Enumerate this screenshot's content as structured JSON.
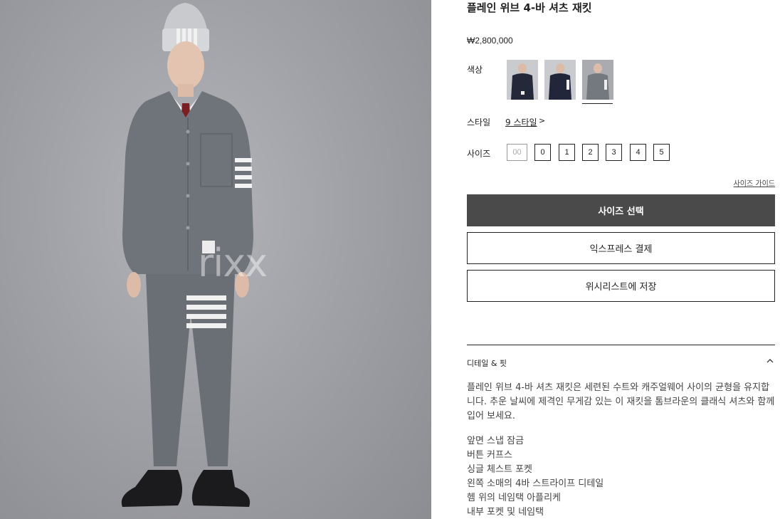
{
  "product": {
    "title": "플레인 위브 4-바 셔츠 재킷",
    "price": "₩2,800,000",
    "watermark": "rixx"
  },
  "color": {
    "label": "색상",
    "swatches": [
      {
        "name": "navy",
        "tone": "#2a3140",
        "selected": false
      },
      {
        "name": "navy-dark",
        "tone": "#262b37",
        "selected": false
      },
      {
        "name": "grey",
        "tone": "#7e8187",
        "selected": true
      }
    ]
  },
  "style": {
    "label": "스타일",
    "link": "9 스타일",
    "chevron": ">"
  },
  "size": {
    "label": "사이즈",
    "options": [
      {
        "value": "00",
        "available": false
      },
      {
        "value": "0",
        "available": true
      },
      {
        "value": "1",
        "available": true
      },
      {
        "value": "2",
        "available": true
      },
      {
        "value": "3",
        "available": true
      },
      {
        "value": "4",
        "available": true
      },
      {
        "value": "5",
        "available": true
      }
    ],
    "guide": "사이즈 가이드"
  },
  "buttons": {
    "select_size": "사이즈 선택",
    "express": "익스프레스 결제",
    "wishlist": "위시리스트에 저장"
  },
  "details": {
    "title": "디테일 & 핏",
    "description": "플레인 위브 4-바 셔츠 재킷은 세련된 수트와 캐주얼웨어 사이의 균형을 유지합니다. 추운 날씨에 제격인 무게감 있는 이 재킷을 톰브라운의 클래식 셔츠와 함께 입어 보세요.",
    "features": [
      "앞면 스냅 잠금",
      "버튼 커프스",
      "싱글 체스트 포켓",
      "왼쪽 소매의 4바 스트라이프 디테일",
      "헴 위의 네임택 아플리케",
      "내부 포켓 및 네임택"
    ]
  },
  "colors": {
    "primary_button": "#4a4a4a",
    "text": "#222222",
    "body_text": "#444444"
  }
}
